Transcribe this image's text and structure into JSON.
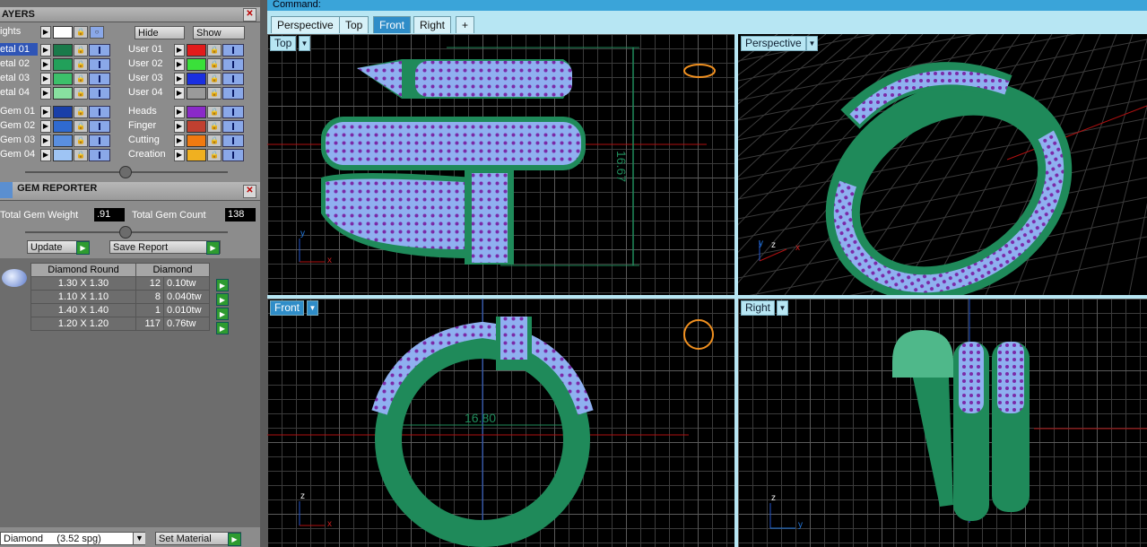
{
  "colors": {
    "accent": "#2f8dc8",
    "tab_bg": "#b7e6f3",
    "command_bar": "#3aa4d9",
    "model": "#1f8a5a",
    "gem": "#8fb0f0",
    "prong": "#7a2aa8"
  },
  "layers_panel": {
    "title": "AYERS",
    "lights_label": "ights",
    "hide_label": "Hide",
    "show_label": "Show",
    "left_layers": [
      {
        "name": "etal 01",
        "color": "#1a7a4a",
        "selected": true
      },
      {
        "name": "etal 02",
        "color": "#22a05a",
        "selected": false
      },
      {
        "name": "etal 03",
        "color": "#3cc06a",
        "selected": false
      },
      {
        "name": "etal 04",
        "color": "#88e0a0",
        "selected": false
      },
      {
        "name": "Gem 01",
        "color": "#1a3fa8",
        "selected": false
      },
      {
        "name": "Gem 02",
        "color": "#2f6ad0",
        "selected": false
      },
      {
        "name": "Gem 03",
        "color": "#5a8fe0",
        "selected": false
      },
      {
        "name": "Gem 04",
        "color": "#9ec4f4",
        "selected": false
      }
    ],
    "right_layers": [
      {
        "name": "User 01",
        "color": "#e21b1b"
      },
      {
        "name": "User 02",
        "color": "#3ae03a"
      },
      {
        "name": "User 03",
        "color": "#1a2fe0"
      },
      {
        "name": "User 04",
        "color": "#9a9a9a"
      },
      {
        "name": "Heads",
        "color": "#8a2ac8"
      },
      {
        "name": "Finger",
        "color": "#c04030"
      },
      {
        "name": "Cutting",
        "color": "#f07a10"
      },
      {
        "name": "Creation",
        "color": "#f0b020"
      }
    ]
  },
  "gem_reporter": {
    "title": "GEM REPORTER",
    "total_weight_label": "Total Gem Weight",
    "total_weight_value": ".91",
    "total_count_label": "Total Gem Count",
    "total_count_value": "138",
    "update_label": "Update",
    "save_report_label": "Save Report",
    "table": {
      "headers": [
        "Diamond Round",
        "Diamond"
      ],
      "rows": [
        {
          "size": "1.30 X 1.30",
          "count": "12",
          "weight": "0.10tw"
        },
        {
          "size": "1.10 X 1.10",
          "count": "8",
          "weight": "0.040tw"
        },
        {
          "size": "1.40 X 1.40",
          "count": "1",
          "weight": "0.010tw"
        },
        {
          "size": "1.20 X 1.20",
          "count": "117",
          "weight": "0.76tw"
        }
      ]
    },
    "material_value": "Diamond     (3.52 spg)",
    "set_material_label": "Set Material"
  },
  "command_label": "Command:",
  "view_tabs": [
    "Perspective",
    "Top",
    "Front",
    "Right",
    "+"
  ],
  "active_view_tab": "Front",
  "viewports": {
    "top": {
      "label": "Top",
      "dimension": "16.67",
      "axes": [
        "y",
        "x"
      ]
    },
    "perspective": {
      "label": "Perspective",
      "axes": [
        "y",
        "z",
        "x"
      ]
    },
    "front": {
      "label": "Front",
      "dimension": "16.80",
      "axes": [
        "z",
        "x"
      ]
    },
    "right": {
      "label": "Right",
      "axes": [
        "z",
        "y"
      ]
    }
  }
}
